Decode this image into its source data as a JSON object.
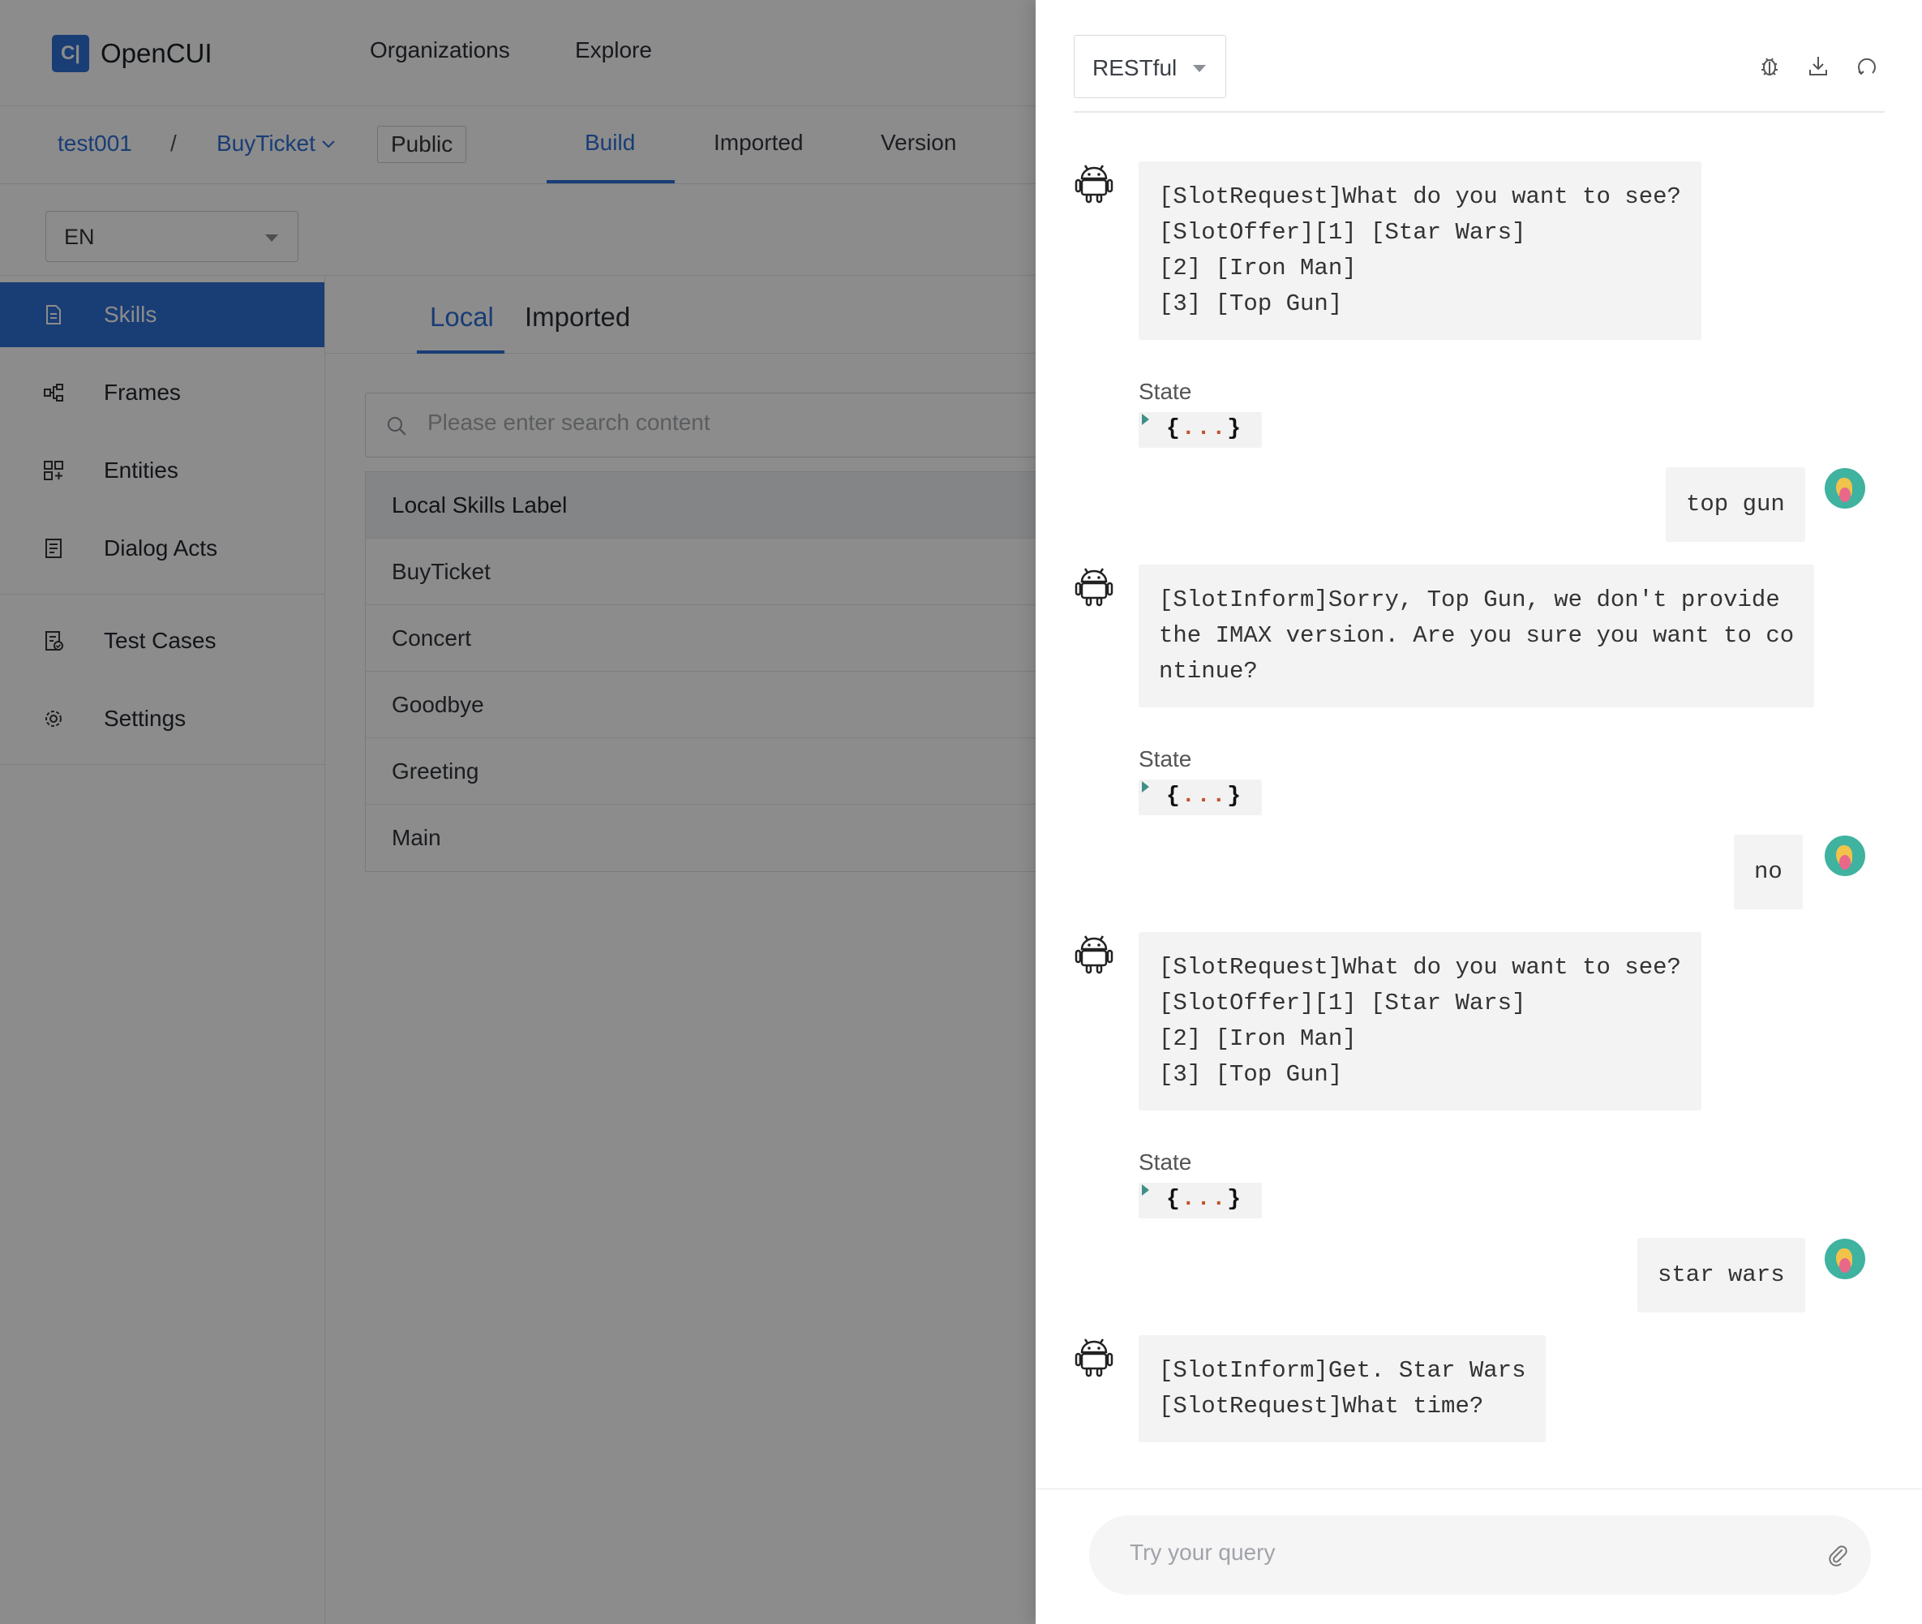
{
  "brand": {
    "logo_glyph": "C|",
    "name": "OpenCUI"
  },
  "topnav": {
    "organizations": "Organizations",
    "explore": "Explore"
  },
  "breadcrumb": {
    "org": "test001",
    "separator": "/",
    "project": "BuyTicket",
    "visibility": "Public"
  },
  "project_tabs": {
    "build": "Build",
    "imported": "Imported",
    "version": "Version"
  },
  "language": {
    "selected": "EN"
  },
  "sidebar": {
    "items": [
      {
        "label": "Skills",
        "icon": "document-icon"
      },
      {
        "label": "Frames",
        "icon": "frames-icon"
      },
      {
        "label": "Entities",
        "icon": "entities-icon"
      },
      {
        "label": "Dialog Acts",
        "icon": "dialog-acts-icon"
      },
      {
        "label": "Test Cases",
        "icon": "test-cases-icon"
      },
      {
        "label": "Settings",
        "icon": "gear-icon"
      }
    ]
  },
  "skills_panel": {
    "tabs": {
      "local": "Local",
      "imported": "Imported"
    },
    "search_placeholder": "Please enter search content",
    "header": "Local Skills Label",
    "rows": [
      "BuyTicket",
      "Concert",
      "Goodbye",
      "Greeting",
      "Main"
    ]
  },
  "drawer": {
    "mode": "RESTful",
    "state_label": "State",
    "state_open": "{",
    "state_dots": "...",
    "state_close": "}",
    "messages": [
      {
        "from": "bot",
        "text": "[SlotRequest]What do you want to see?\n[SlotOffer][1] [Star Wars]\n[2] [Iron Man]\n[3] [Top Gun]"
      },
      {
        "from": "user",
        "text": "top gun"
      },
      {
        "from": "bot",
        "text": "[SlotInform]Sorry, Top Gun, we don't provide\nthe IMAX version. Are you sure you want to co\nntinue?"
      },
      {
        "from": "user",
        "text": "no"
      },
      {
        "from": "bot",
        "text": "[SlotRequest]What do you want to see?\n[SlotOffer][1] [Star Wars]\n[2] [Iron Man]\n[3] [Top Gun]"
      },
      {
        "from": "user",
        "text": "star wars"
      },
      {
        "from": "bot",
        "text": "[SlotInform]Get. Star Wars\n[SlotRequest]What time?"
      }
    ],
    "query_placeholder": "Try your query"
  },
  "colors": {
    "accent": "#2f6fd6",
    "overlay": "rgba(0,0,0,0.45)",
    "bubble": "#f3f3f3"
  }
}
